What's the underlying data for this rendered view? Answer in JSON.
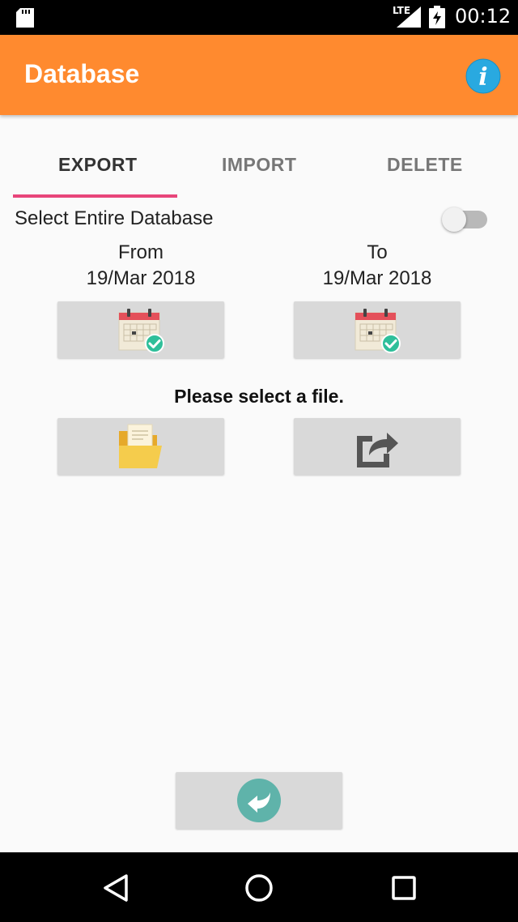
{
  "status_bar": {
    "network": "LTE",
    "time": "00:12"
  },
  "app_bar": {
    "title": "Database",
    "info_icon": "info-icon"
  },
  "tabs": [
    {
      "label": "EXPORT",
      "selected": true
    },
    {
      "label": "IMPORT",
      "selected": false
    },
    {
      "label": "DELETE",
      "selected": false
    }
  ],
  "select_entire_database": {
    "label": "Select Entire Database",
    "enabled": false
  },
  "date_range": {
    "from_label": "From",
    "from_value": "19/Mar 2018",
    "to_label": "To",
    "to_value": "19/Mar 2018"
  },
  "file_prompt": "Please select a file.",
  "colors": {
    "app_bar": "#ff8a2f",
    "tab_indicator": "#e8457a",
    "button_bg": "#d9d9d9",
    "check_green": "#2fbf9a",
    "back_teal": "#5fb3aa"
  },
  "icons": {
    "from_calendar": "calendar-check-icon",
    "to_calendar": "calendar-check-icon",
    "folder": "folder-icon",
    "share": "share-icon",
    "back": "back-arrow-icon"
  }
}
